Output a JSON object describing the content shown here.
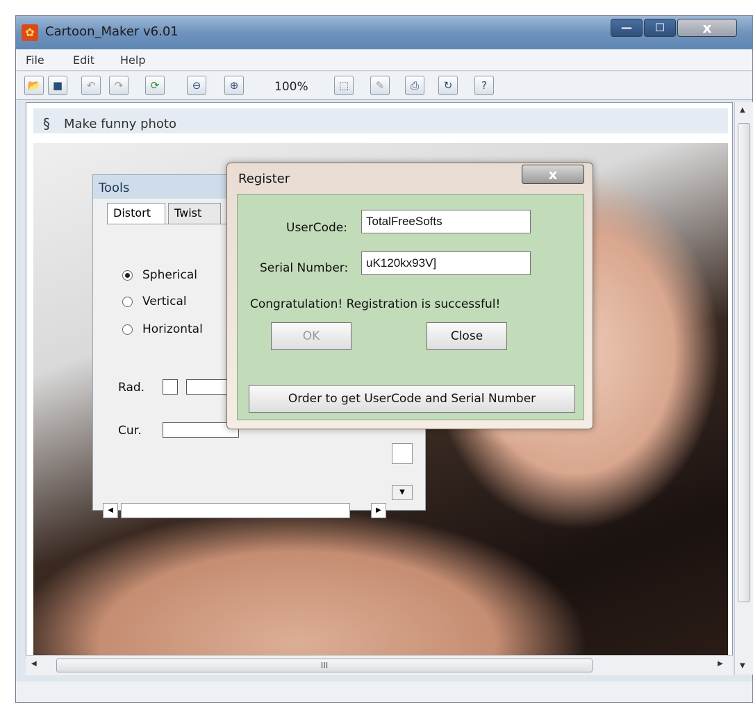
{
  "window": {
    "title": "Cartoon_Maker v6.01",
    "close_label": "x",
    "min_label": "—",
    "max_label": "☐"
  },
  "menu": [
    "File",
    "Edit",
    "Help"
  ],
  "toolbar": {
    "zoom": "100%",
    "icons": [
      "open-folder-icon",
      "save-icon",
      "undo-icon",
      "redo-icon",
      "refresh-icon",
      "zoom-out-icon",
      "zoom-in-icon",
      "select-icon",
      "effect-icon",
      "print-icon",
      "rotate-icon",
      "help-icon"
    ]
  },
  "document": {
    "title": "Make funny photo"
  },
  "tools": {
    "title": "Tools",
    "tabs": [
      "Distort",
      "Twist"
    ],
    "options": [
      "Spherical",
      "Vertical",
      "Horizontal"
    ],
    "selected": "Spherical",
    "rad_label": "Rad.",
    "cur_label": "Cur."
  },
  "register": {
    "title": "Register",
    "close_label": "x",
    "usercode_label": "UserCode:",
    "usercode_value": "TotalFreeSofts",
    "serial_label": "Serial Number:",
    "serial_value": "uK120kx93V]",
    "message": "Congratulation! Registration is successful!",
    "ok_label": "OK",
    "close_button_label": "Close",
    "order_label": "Order to get UserCode and Serial Number"
  },
  "hscroll": {
    "thumb_label": "III"
  }
}
